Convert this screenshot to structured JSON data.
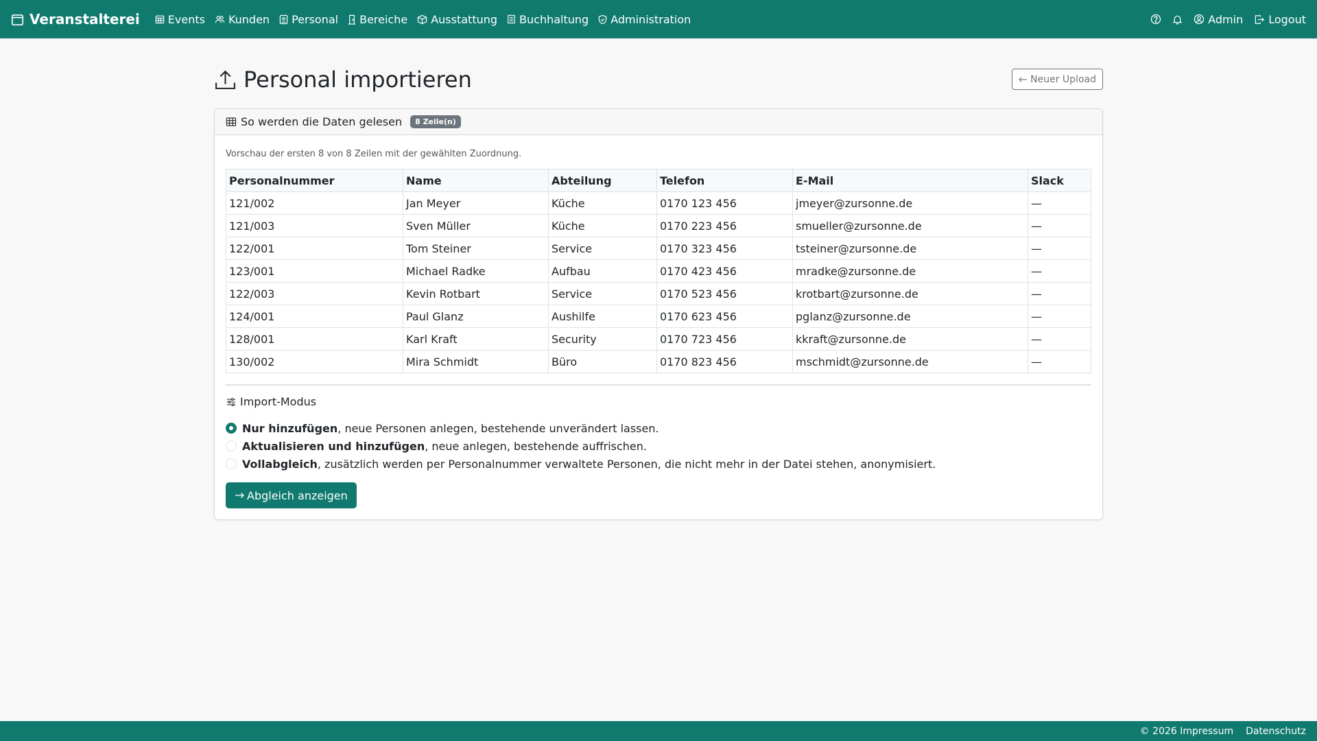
{
  "nav": {
    "brand": "Veranstalterei",
    "items": [
      {
        "label": "Events",
        "icon": "calendar-grid-icon"
      },
      {
        "label": "Kunden",
        "icon": "people-icon"
      },
      {
        "label": "Personal",
        "icon": "badge-icon"
      },
      {
        "label": "Bereiche",
        "icon": "door-icon"
      },
      {
        "label": "Ausstattung",
        "icon": "box-icon"
      },
      {
        "label": "Buchhaltung",
        "icon": "ledger-icon"
      },
      {
        "label": "Administration",
        "icon": "shield-icon"
      }
    ],
    "right": {
      "admin": "Admin",
      "logout": "Logout"
    }
  },
  "page": {
    "title": "Personal importieren",
    "new_upload": "Neuer Upload"
  },
  "card": {
    "title": "So werden die Daten gelesen",
    "badge": "8 Zeile(n)",
    "help": "Vorschau der ersten 8 von 8 Zeilen mit der gewählten Zuordnung."
  },
  "table": {
    "headers": [
      "Personalnummer",
      "Name",
      "Abteilung",
      "Telefon",
      "E-Mail",
      "Slack"
    ],
    "rows": [
      [
        "121/002",
        "Jan Meyer",
        "Küche",
        "0170 123 456",
        "jmeyer@zursonne.de",
        "—"
      ],
      [
        "121/003",
        "Sven Müller",
        "Küche",
        "0170 223 456",
        "smueller@zursonne.de",
        "—"
      ],
      [
        "122/001",
        "Tom Steiner",
        "Service",
        "0170 323 456",
        "tsteiner@zursonne.de",
        "—"
      ],
      [
        "123/001",
        "Michael Radke",
        "Aufbau",
        "0170 423 456",
        "mradke@zursonne.de",
        "—"
      ],
      [
        "122/003",
        "Kevin Rotbart",
        "Service",
        "0170 523 456",
        "krotbart@zursonne.de",
        "—"
      ],
      [
        "124/001",
        "Paul Glanz",
        "Aushilfe",
        "0170 623 456",
        "pglanz@zursonne.de",
        "—"
      ],
      [
        "128/001",
        "Karl Kraft",
        "Security",
        "0170 723 456",
        "kkraft@zursonne.de",
        "—"
      ],
      [
        "130/002",
        "Mira Schmidt",
        "Büro",
        "0170 823 456",
        "mschmidt@zursonne.de",
        "—"
      ]
    ]
  },
  "import_mode": {
    "title": "Import-Modus",
    "options": [
      {
        "bold": "Nur hinzufügen",
        "rest": ", neue Personen anlegen, bestehende unverändert lassen.",
        "checked": true
      },
      {
        "bold": "Aktualisieren und hinzufügen",
        "rest": ", neue anlegen, bestehende auffrischen.",
        "checked": false
      },
      {
        "bold": "Vollabgleich",
        "rest": ", zusätzlich werden per Personalnummer verwaltete Personen, die nicht mehr in der Datei stehen, anonymisiert.",
        "checked": false
      }
    ],
    "submit": "Abgleich anzeigen"
  },
  "footer": {
    "copyright": "© 2026 Impressum",
    "privacy": "Datenschutz"
  },
  "colors": {
    "primary": "#107a6f",
    "background": "#f8f8f8"
  }
}
